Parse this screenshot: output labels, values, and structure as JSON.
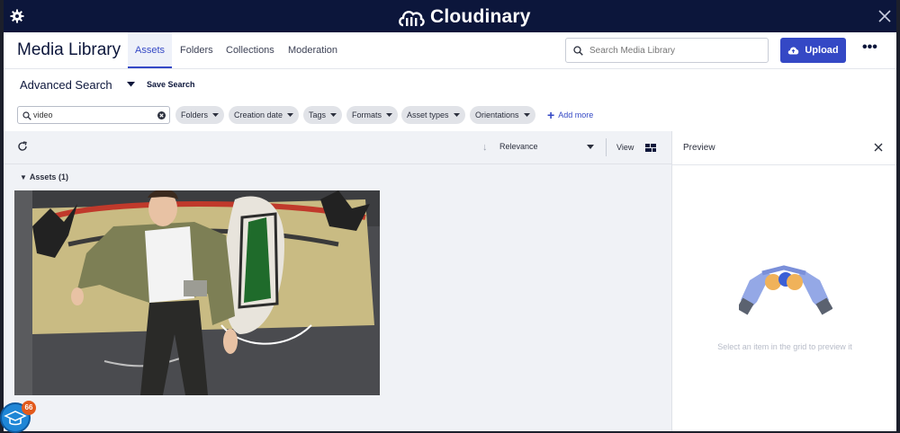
{
  "topbar": {
    "logo_text": "Cloudinary",
    "settings_icon": "gear-icon",
    "close_icon": "close-icon"
  },
  "header": {
    "title": "Media Library",
    "tabs": [
      {
        "label": "Assets",
        "active": true
      },
      {
        "label": "Folders",
        "active": false
      },
      {
        "label": "Collections",
        "active": false
      },
      {
        "label": "Moderation",
        "active": false
      }
    ],
    "search_placeholder": "Search Media Library",
    "upload_label": "Upload",
    "more_label": "•••"
  },
  "advanced_search": {
    "title": "Advanced Search",
    "save_label": "Save Search"
  },
  "filters": {
    "search_term": "video",
    "chips": [
      "Folders",
      "Creation date",
      "Tags",
      "Formats",
      "Asset types",
      "Orientations"
    ],
    "add_more_label": "Add more"
  },
  "grid": {
    "sort_label": "Relevance",
    "view_label": "View",
    "assets_header": "Assets (1)"
  },
  "preview": {
    "title": "Preview",
    "empty_message": "Select an item in the grid to preview it"
  },
  "notification": {
    "count": "66"
  },
  "colors": {
    "topbar_bg": "#0c163b",
    "accent": "#3448c5",
    "badge": "#e25a1c"
  }
}
